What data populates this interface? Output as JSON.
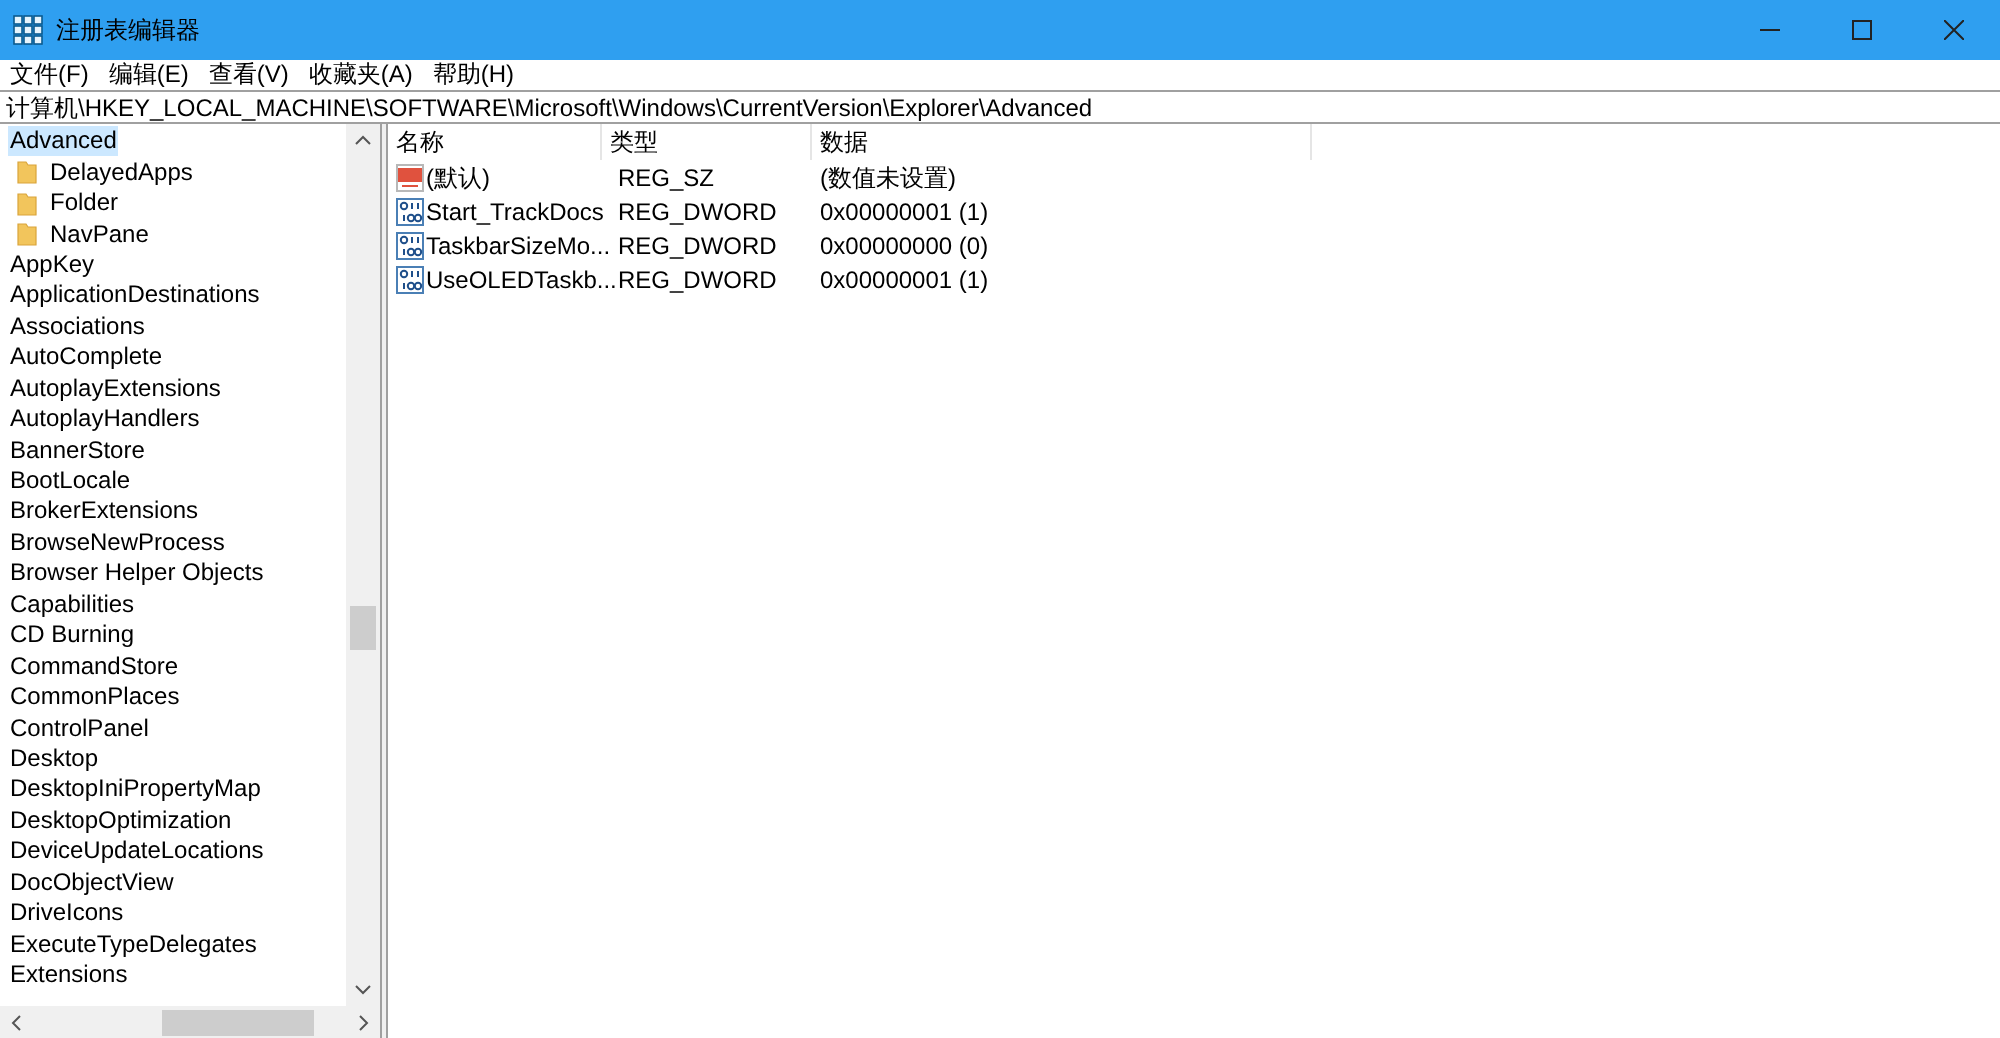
{
  "window": {
    "title": "注册表编辑器"
  },
  "menu": [
    "文件(F)",
    "编辑(E)",
    "查看(V)",
    "收藏夹(A)",
    "帮助(H)"
  ],
  "address": "计算机\\HKEY_LOCAL_MACHINE\\SOFTWARE\\Microsoft\\Windows\\CurrentVersion\\Explorer\\Advanced",
  "tree": [
    {
      "label": "Advanced",
      "selected": true,
      "children": [
        {
          "label": "DelayedApps",
          "selected": false
        },
        {
          "label": "Folder",
          "selected": false
        },
        {
          "label": "NavPane",
          "selected": false
        }
      ]
    },
    {
      "label": "AppKey",
      "selected": false
    },
    {
      "label": "ApplicationDestinations",
      "selected": false
    },
    {
      "label": "Associations",
      "selected": false
    },
    {
      "label": "AutoComplete",
      "selected": false
    },
    {
      "label": "AutoplayExtensions",
      "selected": false
    },
    {
      "label": "AutoplayHandlers",
      "selected": false
    },
    {
      "label": "BannerStore",
      "selected": false
    },
    {
      "label": "BootLocale",
      "selected": false
    },
    {
      "label": "BrokerExtensions",
      "selected": false
    },
    {
      "label": "BrowseNewProcess",
      "selected": false
    },
    {
      "label": "Browser Helper Objects",
      "selected": false
    },
    {
      "label": "Capabilities",
      "selected": false
    },
    {
      "label": "CD Burning",
      "selected": false
    },
    {
      "label": "CommandStore",
      "selected": false
    },
    {
      "label": "CommonPlaces",
      "selected": false
    },
    {
      "label": "ControlPanel",
      "selected": false
    },
    {
      "label": "Desktop",
      "selected": false
    },
    {
      "label": "DesktopIniPropertyMap",
      "selected": false
    },
    {
      "label": "DesktopOptimization",
      "selected": false
    },
    {
      "label": "DeviceUpdateLocations",
      "selected": false
    },
    {
      "label": "DocObjectView",
      "selected": false
    },
    {
      "label": "DriveIcons",
      "selected": false
    },
    {
      "label": "ExecuteTypeDelegates",
      "selected": false
    },
    {
      "label": "Extensions",
      "selected": false
    }
  ],
  "columns": [
    "名称",
    "类型",
    "数据"
  ],
  "values": [
    {
      "kind": "string",
      "name": "(默认)",
      "type": "REG_SZ",
      "data": "(数值未设置)"
    },
    {
      "kind": "dword",
      "name": "Start_TrackDocs",
      "type": "REG_DWORD",
      "data": "0x00000001 (1)"
    },
    {
      "kind": "dword",
      "name": "TaskbarSizeMo...",
      "type": "REG_DWORD",
      "data": "0x00000000 (0)"
    },
    {
      "kind": "dword",
      "name": "UseOLEDTaskb...",
      "type": "REG_DWORD",
      "data": "0x00000001 (1)"
    }
  ]
}
